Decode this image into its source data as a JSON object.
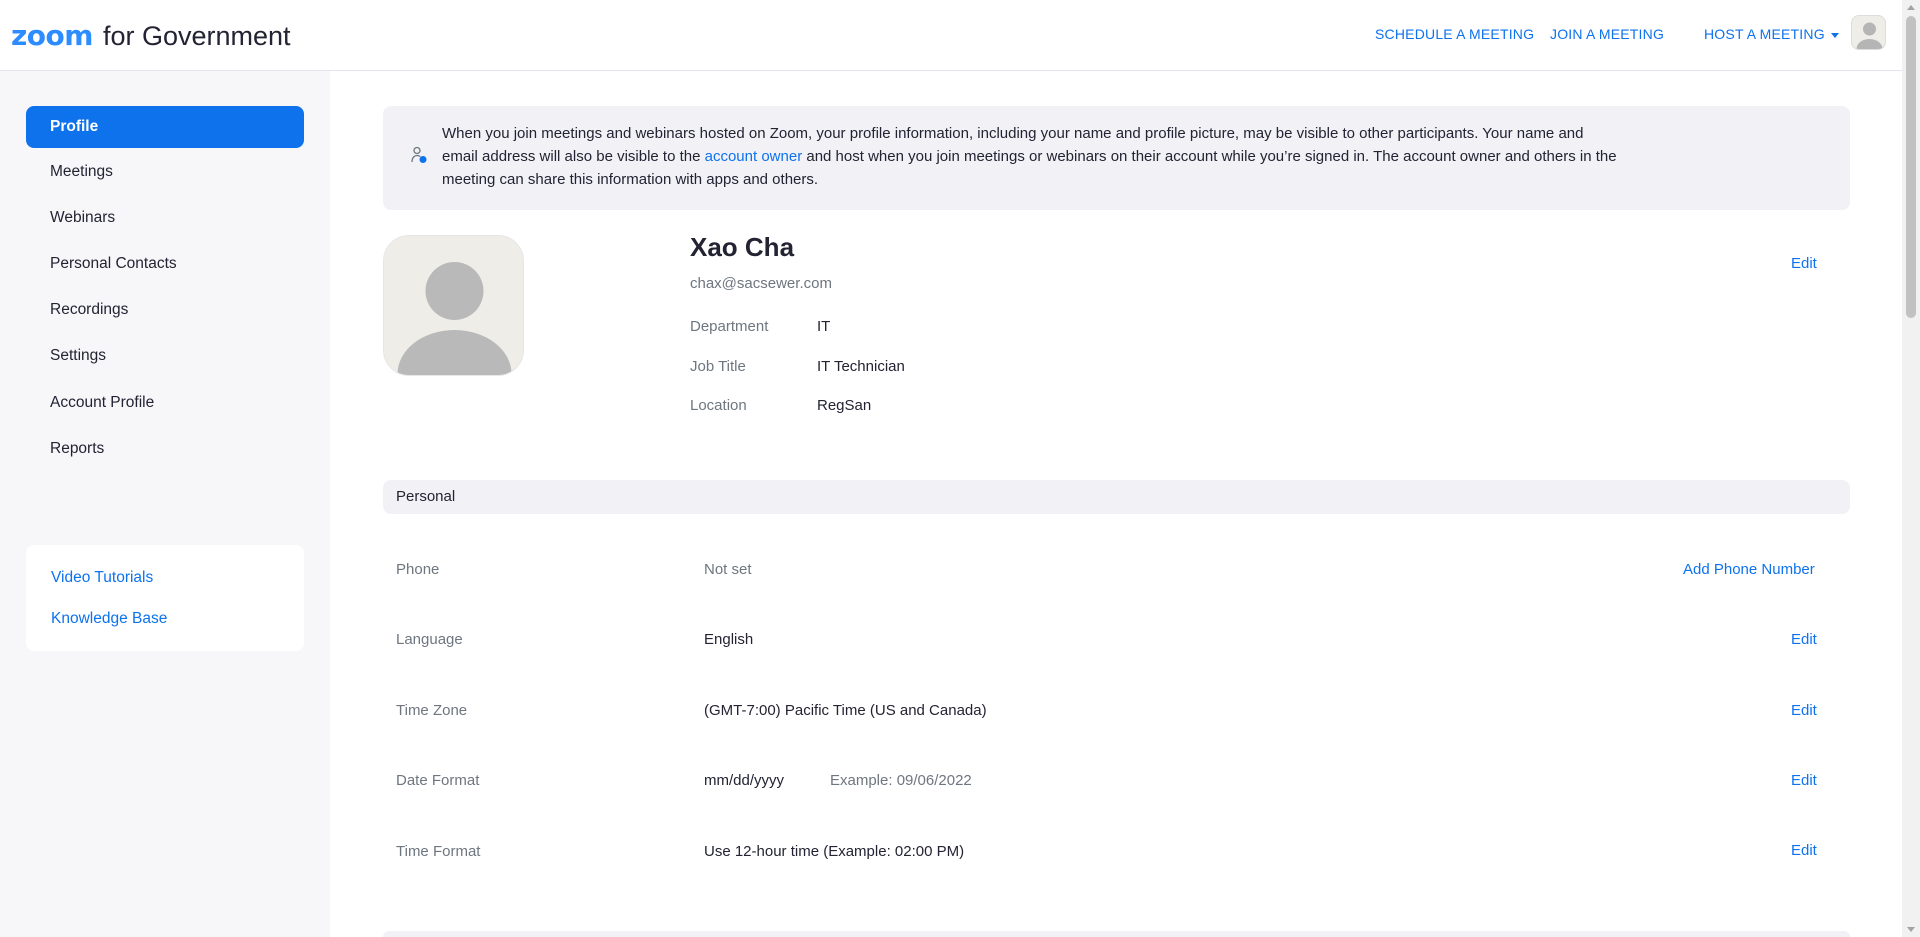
{
  "header": {
    "logo_brand": "zoom",
    "logo_suffix": "for Government",
    "nav": {
      "schedule": "SCHEDULE A MEETING",
      "join": "JOIN A MEETING",
      "host": "HOST A MEETING"
    },
    "avatar_icon": "user-avatar-icon"
  },
  "sidebar": {
    "items": [
      {
        "label": "Profile",
        "active": true
      },
      {
        "label": "Meetings"
      },
      {
        "label": "Webinars"
      },
      {
        "label": "Personal Contacts"
      },
      {
        "label": "Recordings"
      },
      {
        "label": "Settings"
      },
      {
        "label": "Account Profile"
      },
      {
        "label": "Reports"
      }
    ],
    "help_links": [
      "Video Tutorials",
      "Knowledge Base"
    ]
  },
  "notice": {
    "text_before": "When you join meetings and webinars hosted on Zoom, your profile information, including your name and profile picture, may be visible to other participants. Your name and email address will also be visible to the ",
    "link": "account owner",
    "text_after": " and host when you join meetings or webinars on their account while you’re signed in. The account owner and others in the meeting can share this information with apps and others.",
    "icon": "user-privacy-icon"
  },
  "profile": {
    "name": "Xao Cha",
    "email": "chax@sacsewer.com",
    "edit_label": "Edit",
    "fields": [
      {
        "label": "Department",
        "value": "IT"
      },
      {
        "label": "Job Title",
        "value": "IT Technician"
      },
      {
        "label": "Location",
        "value": "RegSan"
      }
    ]
  },
  "personal": {
    "section_title": "Personal",
    "rows": [
      {
        "label": "Phone",
        "value": "Not set",
        "action": "Add Phone Number"
      },
      {
        "label": "Language",
        "value": "English",
        "action": "Edit"
      },
      {
        "label": "Time Zone",
        "value": "(GMT-7:00) Pacific Time (US and Canada)",
        "action": "Edit"
      },
      {
        "label": "Date Format",
        "value": "mm/dd/yyyy",
        "extra": "Example: 09/06/2022",
        "action": "Edit"
      },
      {
        "label": "Time Format",
        "value": "Use 12-hour time (Example: 02:00 PM)",
        "action": "Edit"
      }
    ]
  },
  "colors": {
    "accent": "#0e72ed",
    "logo_blue": "#2d8cff",
    "panel_bg": "#f1f1f6",
    "sidebar_bg": "#f7f7fa"
  }
}
